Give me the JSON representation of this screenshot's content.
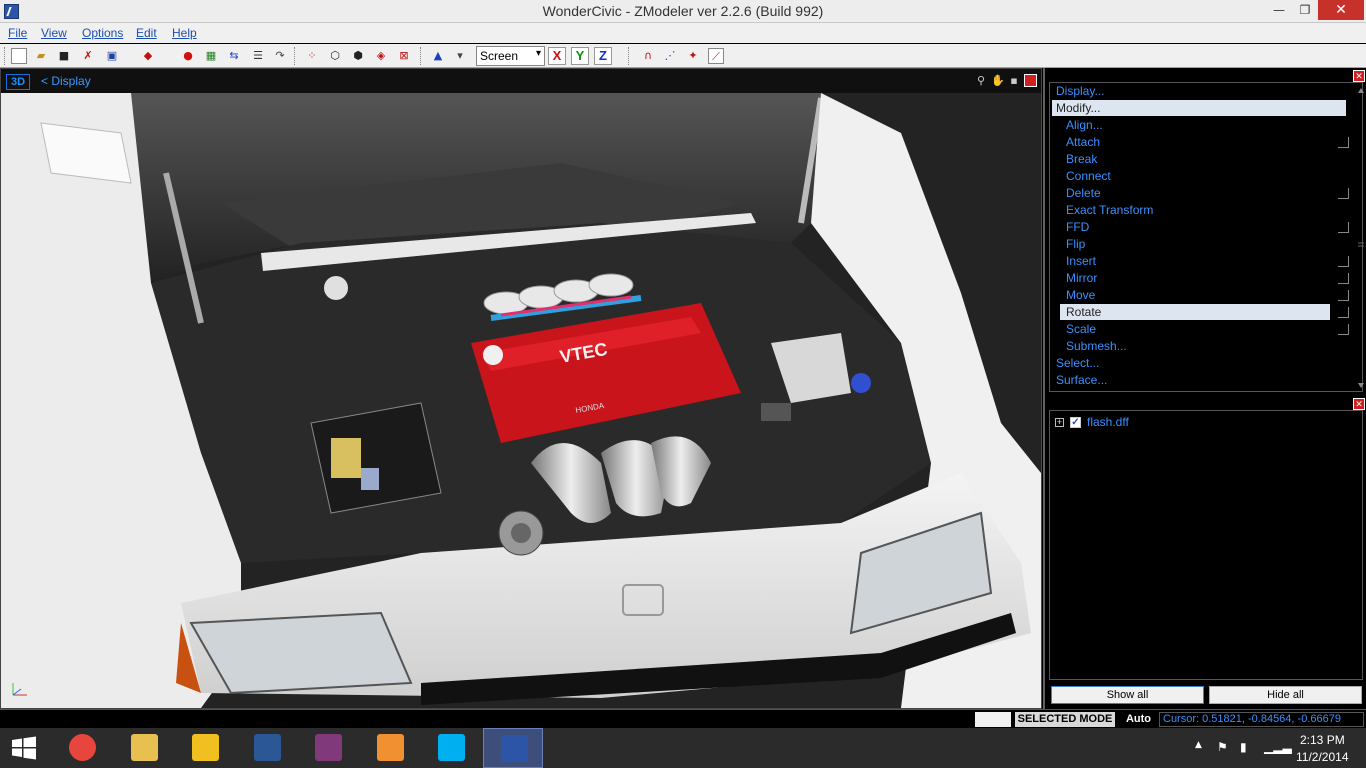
{
  "window": {
    "title": "WonderCivic - ZModeler ver 2.2.6 (Build 992)",
    "minimize": "—",
    "maximize": "❐",
    "close": "✕"
  },
  "menu": [
    "File",
    "View",
    "Options",
    "Edit",
    "Help"
  ],
  "toolbar": {
    "coord_system": "Screen",
    "axis_x": "X",
    "axis_y": "Y",
    "axis_z": "Z",
    "colors": {
      "axis_x": "#d01010",
      "axis_y": "#109010",
      "axis_z": "#1030d0"
    }
  },
  "viewport": {
    "mode": "3D",
    "title": "<  Display"
  },
  "commands": {
    "items": [
      {
        "label": "Display...",
        "level": 0,
        "highlight": false,
        "box": false
      },
      {
        "label": "Modify...",
        "level": 0,
        "highlight": true,
        "box": false
      },
      {
        "label": "Align...",
        "level": 1,
        "highlight": false,
        "box": false
      },
      {
        "label": "Attach",
        "level": 1,
        "highlight": false,
        "box": true
      },
      {
        "label": "Break",
        "level": 1,
        "highlight": false,
        "box": false
      },
      {
        "label": "Connect",
        "level": 1,
        "highlight": false,
        "box": false
      },
      {
        "label": "Delete",
        "level": 1,
        "highlight": false,
        "box": true
      },
      {
        "label": "Exact Transform",
        "level": 1,
        "highlight": false,
        "box": false
      },
      {
        "label": "FFD",
        "level": 1,
        "highlight": false,
        "box": true
      },
      {
        "label": "Flip",
        "level": 1,
        "highlight": false,
        "box": false
      },
      {
        "label": "Insert",
        "level": 1,
        "highlight": false,
        "box": true
      },
      {
        "label": "Mirror",
        "level": 1,
        "highlight": false,
        "box": true
      },
      {
        "label": "Move",
        "level": 1,
        "highlight": false,
        "box": true
      },
      {
        "label": "Rotate",
        "level": 1,
        "highlight": true,
        "box": true
      },
      {
        "label": "Scale",
        "level": 1,
        "highlight": false,
        "box": true
      },
      {
        "label": "Submesh...",
        "level": 1,
        "highlight": false,
        "box": false
      },
      {
        "label": "Select...",
        "level": 0,
        "highlight": false,
        "box": false
      },
      {
        "label": "Surface...",
        "level": 0,
        "highlight": false,
        "box": false
      }
    ]
  },
  "tree": {
    "expand": "+",
    "check": "✓",
    "file": "flash.dff"
  },
  "panel_buttons": {
    "show_all": "Show all",
    "hide_all": "Hide all"
  },
  "status": {
    "mode": "SELECTED MODE",
    "auto": "Auto",
    "cursor": "Cursor: 0.51821, -0.84564, -0.66679"
  },
  "taskbar": {
    "apps": [
      {
        "name": "chrome",
        "color": "#e8453c"
      },
      {
        "name": "file-explorer",
        "color": "#e8c050"
      },
      {
        "name": "outlook",
        "color": "#f0c020"
      },
      {
        "name": "word",
        "color": "#2b5797"
      },
      {
        "name": "onenote",
        "color": "#80397b"
      },
      {
        "name": "media-player",
        "color": "#f09030"
      },
      {
        "name": "skype",
        "color": "#00aff0"
      },
      {
        "name": "zmodeler",
        "color": "#2c55a8"
      }
    ],
    "time": "2:13 PM",
    "date": "11/2/2014"
  }
}
